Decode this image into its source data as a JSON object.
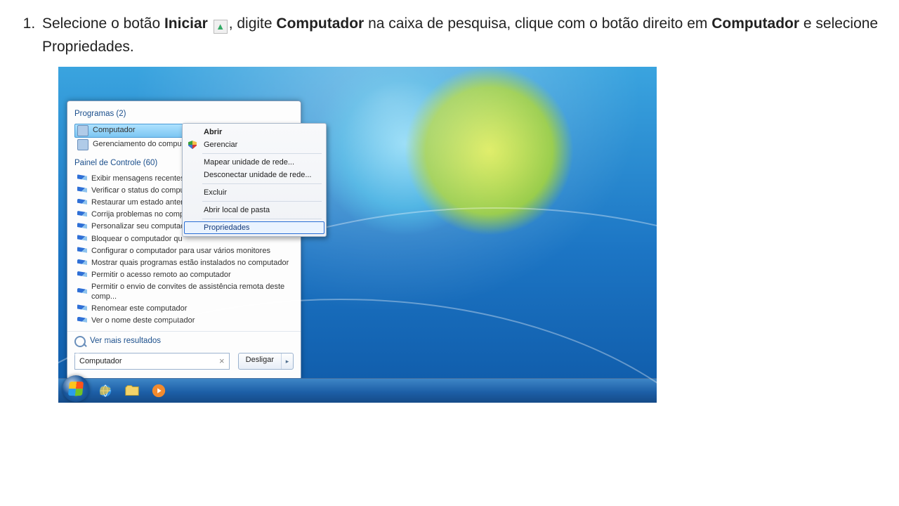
{
  "instruction": {
    "number": "1.",
    "parts": {
      "p1": "Selecione o botão ",
      "b1": "Iniciar",
      "img_alt": "Ícone do botão Iniciar",
      "p2": ", digite ",
      "b2": "Computador",
      "p3": " na caixa de pesquisa, clique com o botão direito em ",
      "b3": "Computador",
      "p4": " e selecione Propriedades."
    }
  },
  "startmenu": {
    "programs_heading": "Programas (2)",
    "programs": [
      {
        "label": "Computador",
        "selected": true
      },
      {
        "label": "Gerenciamento do comput"
      }
    ],
    "cp_heading": "Painel de Controle (60)",
    "cp_items": [
      "Exibir mensagens recentes",
      "Verificar o status do compu",
      "Restaurar um estado anteri",
      "Corrija problemas no comp",
      "Personalizar seu computad",
      "Bloquear o computador qu",
      "Configurar o computador para usar vários monitores",
      "Mostrar quais programas estão instalados no computador",
      "Permitir o acesso remoto ao computador",
      "Permitir o envio de convites de assistência remota deste comp...",
      "Renomear este computador",
      "Ver o nome deste computador"
    ],
    "more_results": "Ver mais resultados",
    "search_value": "Computador",
    "shutdown_label": "Desligar"
  },
  "context_menu": {
    "items": [
      {
        "label": "Abrir",
        "bold": true
      },
      {
        "label": "Gerenciar",
        "shield": true
      },
      {
        "sep": true
      },
      {
        "label": "Mapear unidade de rede..."
      },
      {
        "label": "Desconectar unidade de rede..."
      },
      {
        "sep": true
      },
      {
        "label": "Excluir"
      },
      {
        "sep": true
      },
      {
        "label": "Abrir local de pasta"
      },
      {
        "sep": true
      },
      {
        "label": "Propriedades",
        "highlight": true
      }
    ]
  }
}
